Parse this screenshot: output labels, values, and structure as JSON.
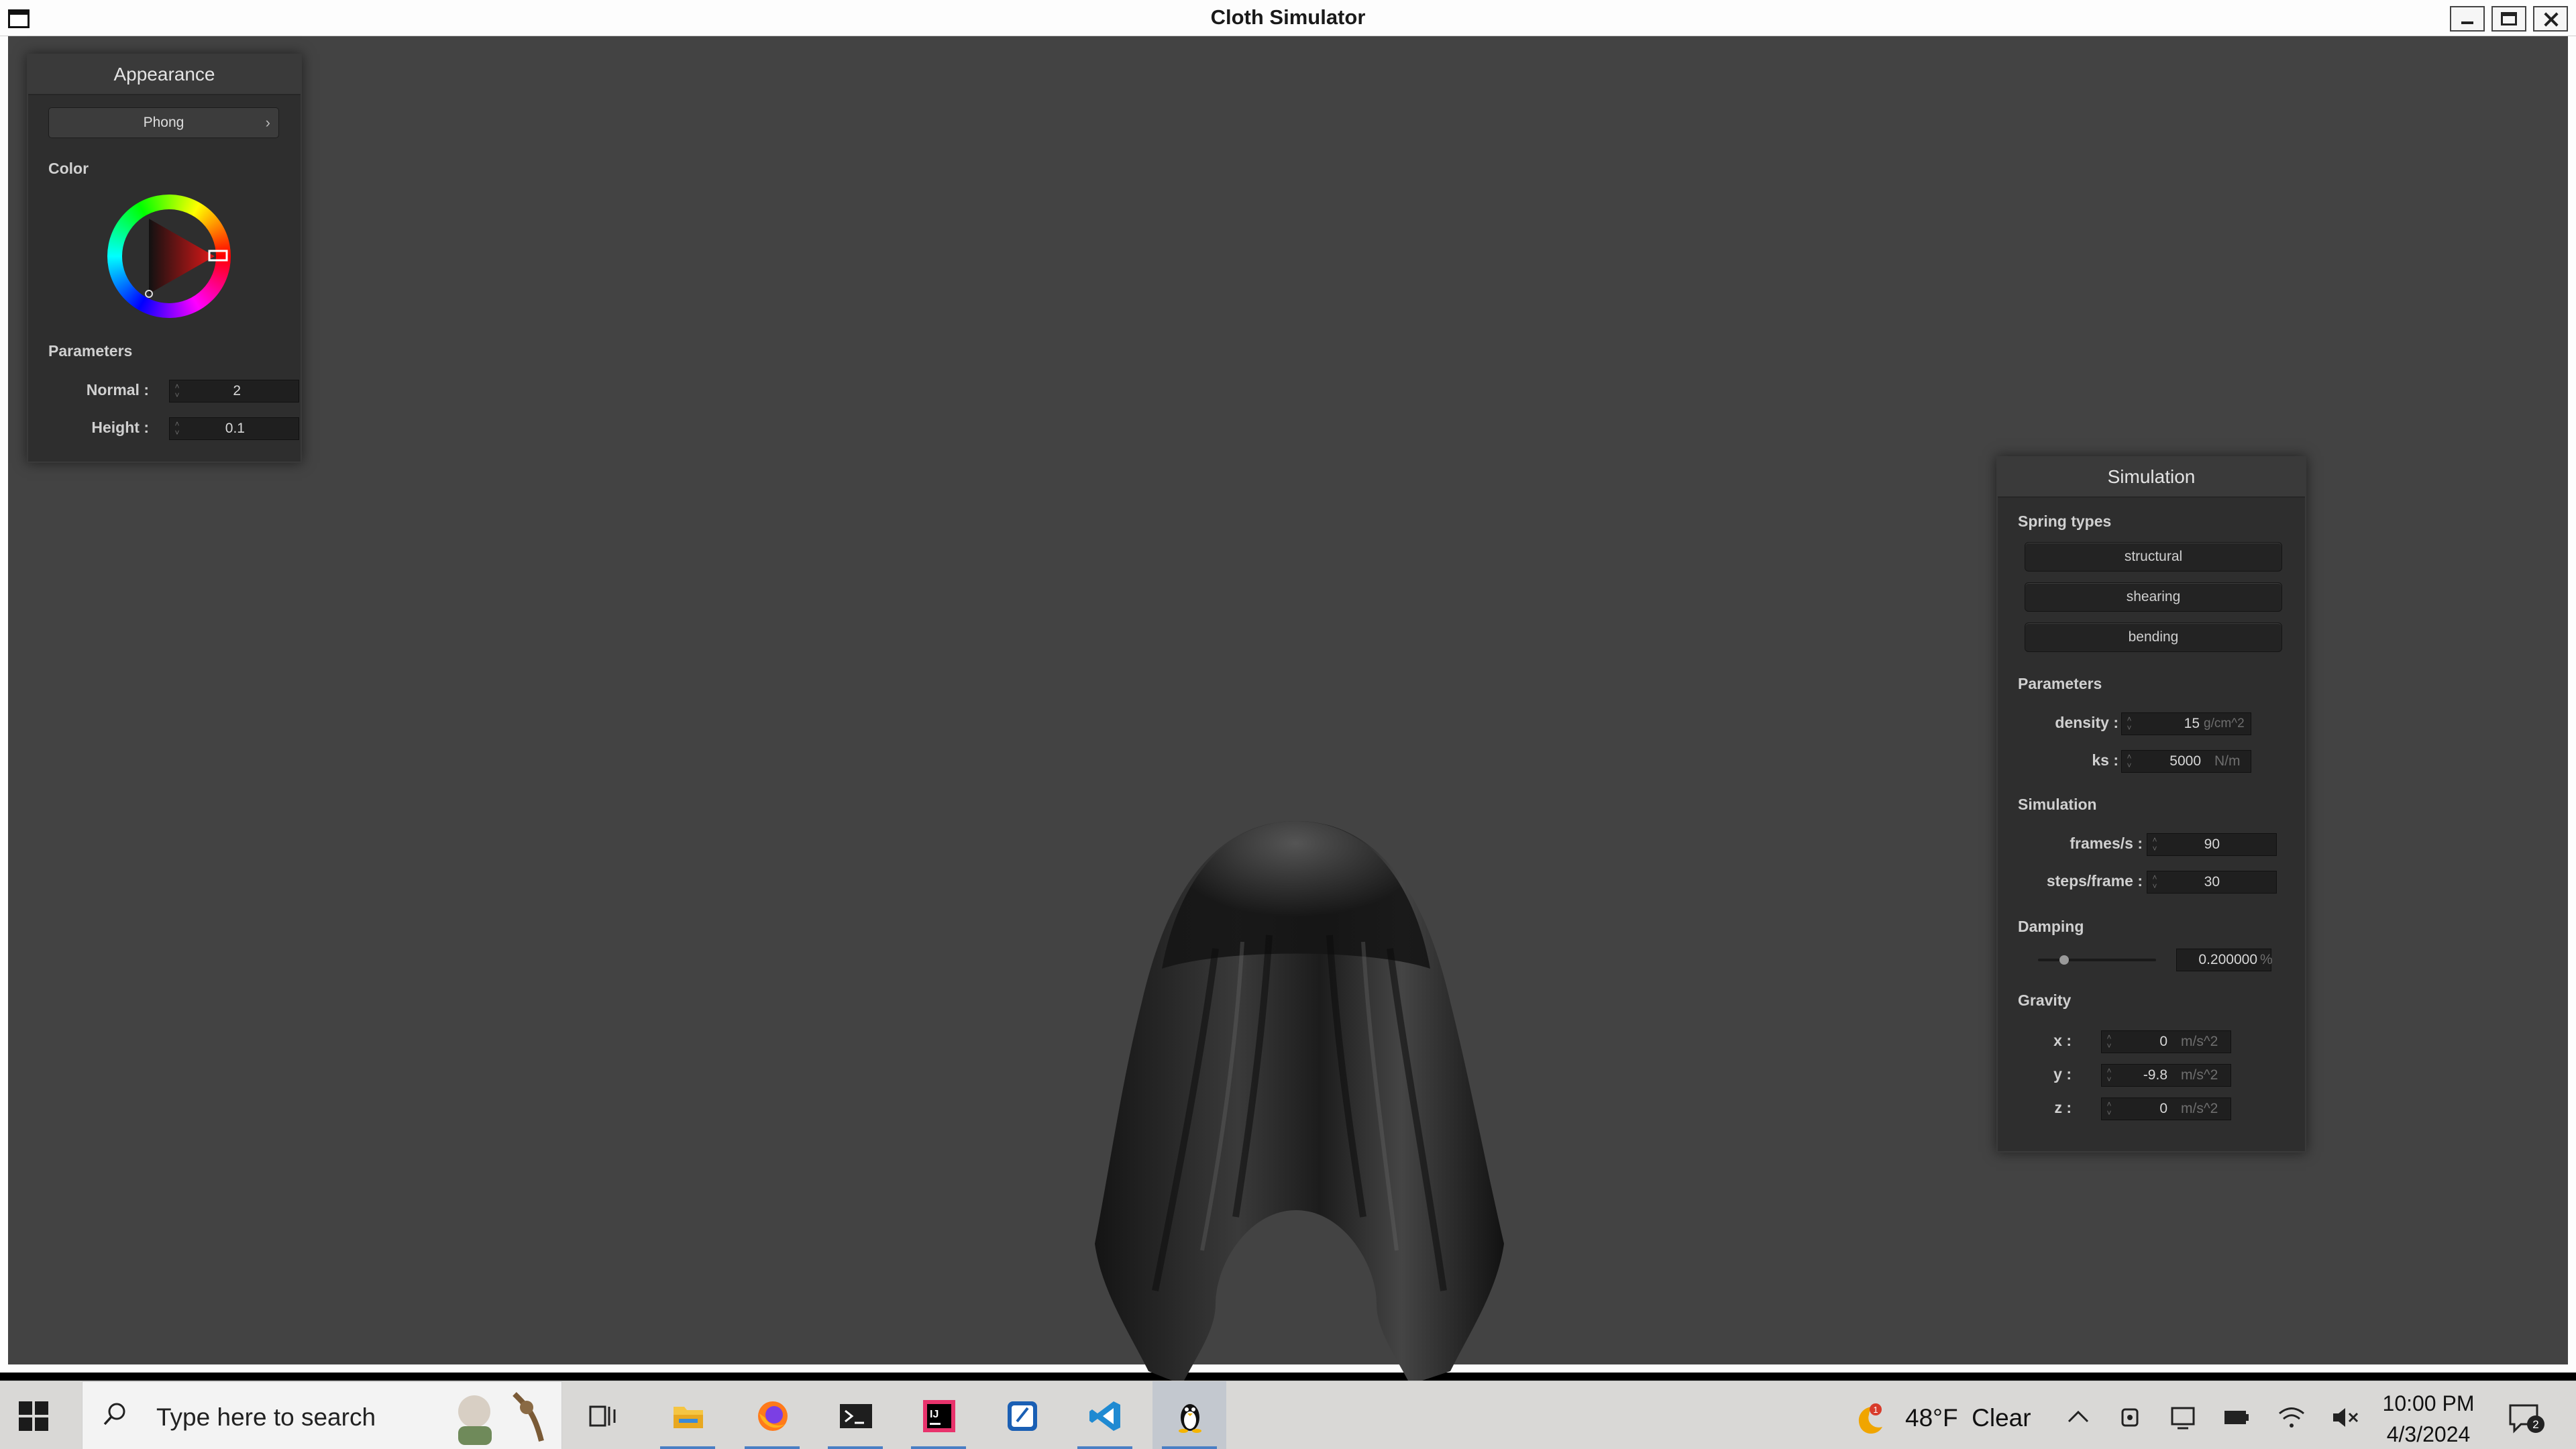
{
  "window": {
    "title": "Cloth Simulator"
  },
  "appearance": {
    "header": "Appearance",
    "shader": "Phong",
    "color_label": "Color",
    "parameters_label": "Parameters",
    "normal": {
      "label": "Normal :",
      "value": "2"
    },
    "height": {
      "label": "Height :",
      "value": "0.1"
    }
  },
  "simulation": {
    "header": "Simulation",
    "spring_types_label": "Spring types",
    "springs": [
      "structural",
      "shearing",
      "bending"
    ],
    "parameters_label": "Parameters",
    "density": {
      "label": "density :",
      "value": "15",
      "unit": "g/cm^2"
    },
    "ks": {
      "label": "ks :",
      "value": "5000",
      "unit": "N/m"
    },
    "simulation_label": "Simulation",
    "frames": {
      "label": "frames/s :",
      "value": "90"
    },
    "steps": {
      "label": "steps/frame :",
      "value": "30"
    },
    "damping_label": "Damping",
    "damping": {
      "value": "0.200000",
      "unit": "%",
      "slider_fraction": 0.2
    },
    "gravity_label": "Gravity",
    "gx": {
      "label": "x :",
      "value": "0",
      "unit": "m/s^2"
    },
    "gy": {
      "label": "y :",
      "value": "-9.8",
      "unit": "m/s^2"
    },
    "gz": {
      "label": "z :",
      "value": "0",
      "unit": "m/s^2"
    }
  },
  "taskbar": {
    "search_placeholder": "Type here to search",
    "apps": [
      "task-view",
      "file-explorer",
      "firefox",
      "terminal",
      "intellij",
      "editor",
      "vscode",
      "linux"
    ],
    "weather": {
      "temp": "48°F",
      "condition": "Clear",
      "badge": "1"
    },
    "time": "10:00 PM",
    "date": "4/3/2024",
    "notifications": "2"
  },
  "colors": {
    "viewport": "#434343",
    "panel": "#2e2e2e",
    "accent": "#4a7fc4"
  }
}
